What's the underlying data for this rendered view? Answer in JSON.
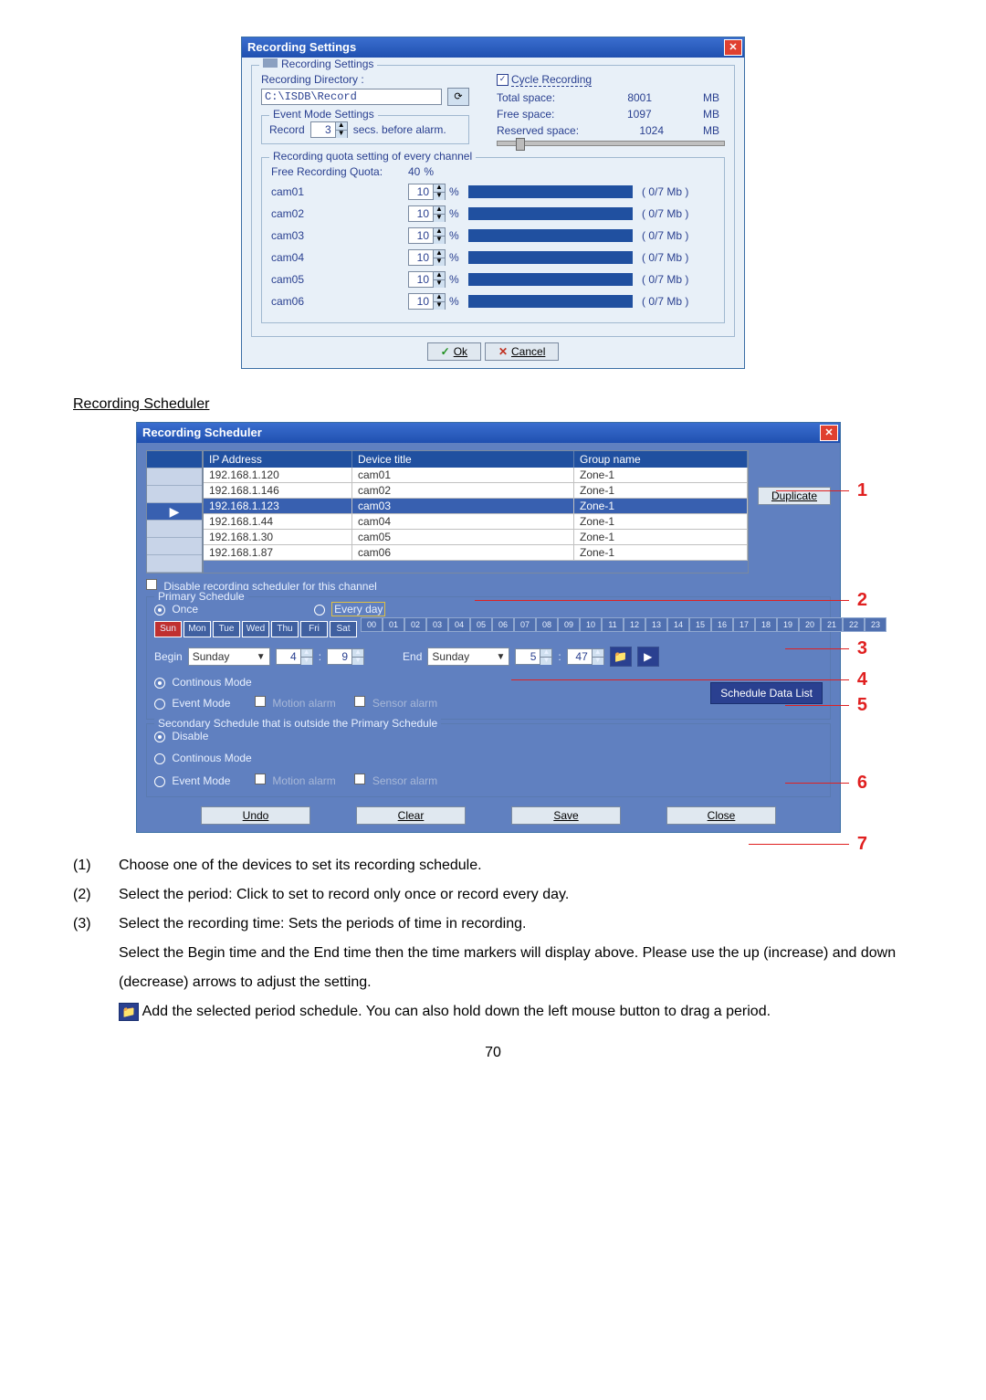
{
  "page_number": "70",
  "settings_dialog": {
    "title": "Recording Settings",
    "inner_title": "Recording Settings",
    "rec_dir_label": "Recording Directory :",
    "rec_dir_value": "C:\\ISDB\\Record",
    "cycle_recording_label": "Cycle Recording",
    "cycle_recording_checked": "✓",
    "total_space_label": "Total space:",
    "total_space_value": "8001",
    "free_space_label": "Free space:",
    "free_space_value": "1097",
    "reserved_space_label": "Reserved space:",
    "reserved_space_value": "1024",
    "unit_mb": "MB",
    "event_mode_title": "Event Mode Settings",
    "record_label": "Record",
    "record_secs_value": "3",
    "secs_before_alarm": "secs. before alarm.",
    "quota_title": "Recording quota setting of every channel",
    "free_quota_label": "Free Recording Quota:",
    "free_quota_value": "40",
    "pct": "%",
    "cams": [
      {
        "name": "cam01",
        "val": "10",
        "stat": "( 0/7 Mb )"
      },
      {
        "name": "cam02",
        "val": "10",
        "stat": "( 0/7 Mb )"
      },
      {
        "name": "cam03",
        "val": "10",
        "stat": "( 0/7 Mb )"
      },
      {
        "name": "cam04",
        "val": "10",
        "stat": "( 0/7 Mb )"
      },
      {
        "name": "cam05",
        "val": "10",
        "stat": "( 0/7 Mb )"
      },
      {
        "name": "cam06",
        "val": "10",
        "stat": "( 0/7 Mb )"
      }
    ],
    "ok_label": "Ok",
    "cancel_label": "Cancel"
  },
  "scheduler_heading": "Recording Scheduler",
  "scheduler_dialog": {
    "title": "Recording Scheduler",
    "dev_headers": {
      "ip": "IP Address",
      "title": "Device title",
      "group": "Group name"
    },
    "devices": [
      {
        "ip": "192.168.1.120",
        "title": "cam01",
        "group": "Zone-1",
        "selected": false
      },
      {
        "ip": "192.168.1.146",
        "title": "cam02",
        "group": "Zone-1",
        "selected": false
      },
      {
        "ip": "192.168.1.123",
        "title": "cam03",
        "group": "Zone-1",
        "selected": true
      },
      {
        "ip": "192.168.1.44",
        "title": "cam04",
        "group": "Zone-1",
        "selected": false
      },
      {
        "ip": "192.168.1.30",
        "title": "cam05",
        "group": "Zone-1",
        "selected": false
      },
      {
        "ip": "192.168.1.87",
        "title": "cam06",
        "group": "Zone-1",
        "selected": false
      }
    ],
    "duplicate_label": "Duplicate",
    "disable_rec_scheduler_label": "Disable recording scheduler for this channel",
    "primary_title": "Primary Schedule",
    "once_label": "Once",
    "every_day_label": "Every day",
    "days": [
      "Sun",
      "Mon",
      "Tue",
      "Wed",
      "Thu",
      "Fri",
      "Sat"
    ],
    "hours": [
      "00",
      "01",
      "02",
      "03",
      "04",
      "05",
      "06",
      "07",
      "08",
      "09",
      "10",
      "11",
      "12",
      "13",
      "14",
      "15",
      "16",
      "17",
      "18",
      "19",
      "20",
      "21",
      "22",
      "23"
    ],
    "begin_label": "Begin",
    "begin_day": "Sunday",
    "begin_h": "4",
    "begin_m": "9",
    "end_label": "End",
    "end_day": "Sunday",
    "end_h": "5",
    "end_m": "47",
    "continuous_label": "Continous Mode",
    "event_mode_label": "Event Mode",
    "motion_alarm_label": "Motion alarm",
    "sensor_alarm_label": "Sensor alarm",
    "schedule_data_list_label": "Schedule Data List",
    "secondary_title": "Secondary Schedule that is outside the Primary Schedule",
    "disable_label": "Disable",
    "undo_label": "Undo",
    "clear_label": "Clear",
    "save_label": "Save",
    "close_label": "Close"
  },
  "callouts": {
    "c1": "1",
    "c2": "2",
    "c3": "3",
    "c4": "4",
    "c5": "5",
    "c6": "6",
    "c7": "7"
  },
  "instructions": {
    "i1n": "(1)",
    "i1": "Choose one of the devices to set its recording schedule.",
    "i2n": "(2)",
    "i2": "Select the period: Click to set to record only once or record every day.",
    "i3n": "(3)",
    "i3": "Select the recording time: Sets the periods of time in recording.",
    "i3b": "Select the Begin time and the End time then the time markers will display above. Please use the up (increase) and down (decrease) arrows to adjust the setting.",
    "i3c": "Add the selected period schedule. You can also hold down the left mouse button to drag a period."
  }
}
